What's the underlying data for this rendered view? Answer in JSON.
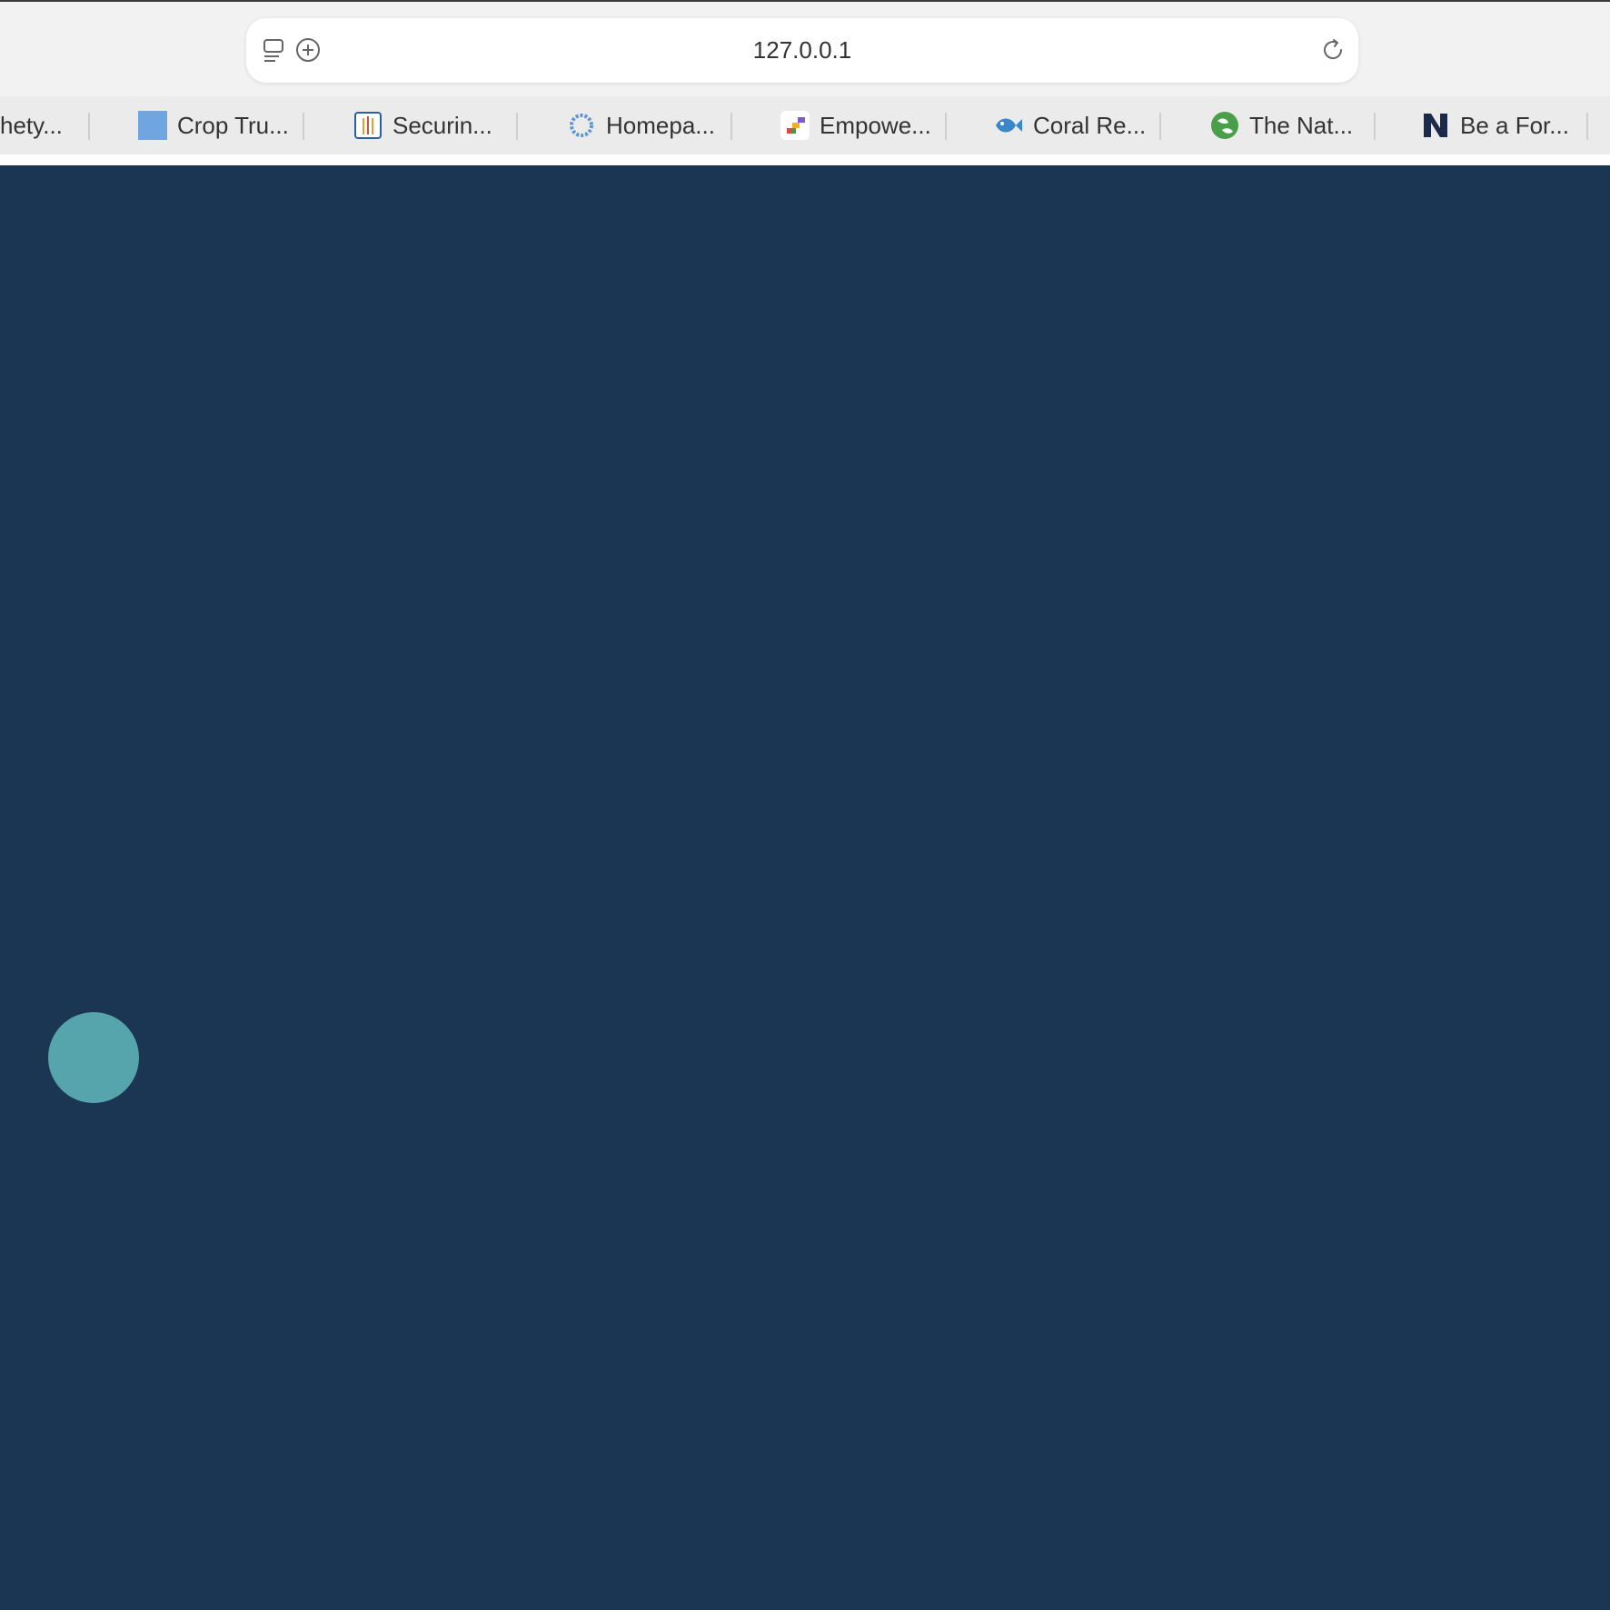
{
  "address_bar": {
    "url": "127.0.0.1"
  },
  "icons": {
    "sidebar": "sidebar-icon",
    "add_tab": "plus-circle-icon",
    "reload": "reload-icon"
  },
  "bookmarks": [
    {
      "label": "hety...",
      "favicon": "none"
    },
    {
      "label": "Crop Tru...",
      "favicon": "blue-square-icon"
    },
    {
      "label": "Securin...",
      "favicon": "wheat-icon"
    },
    {
      "label": "Homepa...",
      "favicon": "ring-icon"
    },
    {
      "label": "Empowe...",
      "favicon": "colorful-stripes-icon"
    },
    {
      "label": "Coral Re...",
      "favicon": "fish-icon"
    },
    {
      "label": "The Nat...",
      "favicon": "globe-leaf-icon"
    },
    {
      "label": "Be a For...",
      "favicon": "letter-n-icon"
    }
  ],
  "colors": {
    "page_background": "#1b3652",
    "circle": "#56a5ac",
    "chrome": "#f2f2f2",
    "bookmarks_bar": "#ebebeb"
  }
}
